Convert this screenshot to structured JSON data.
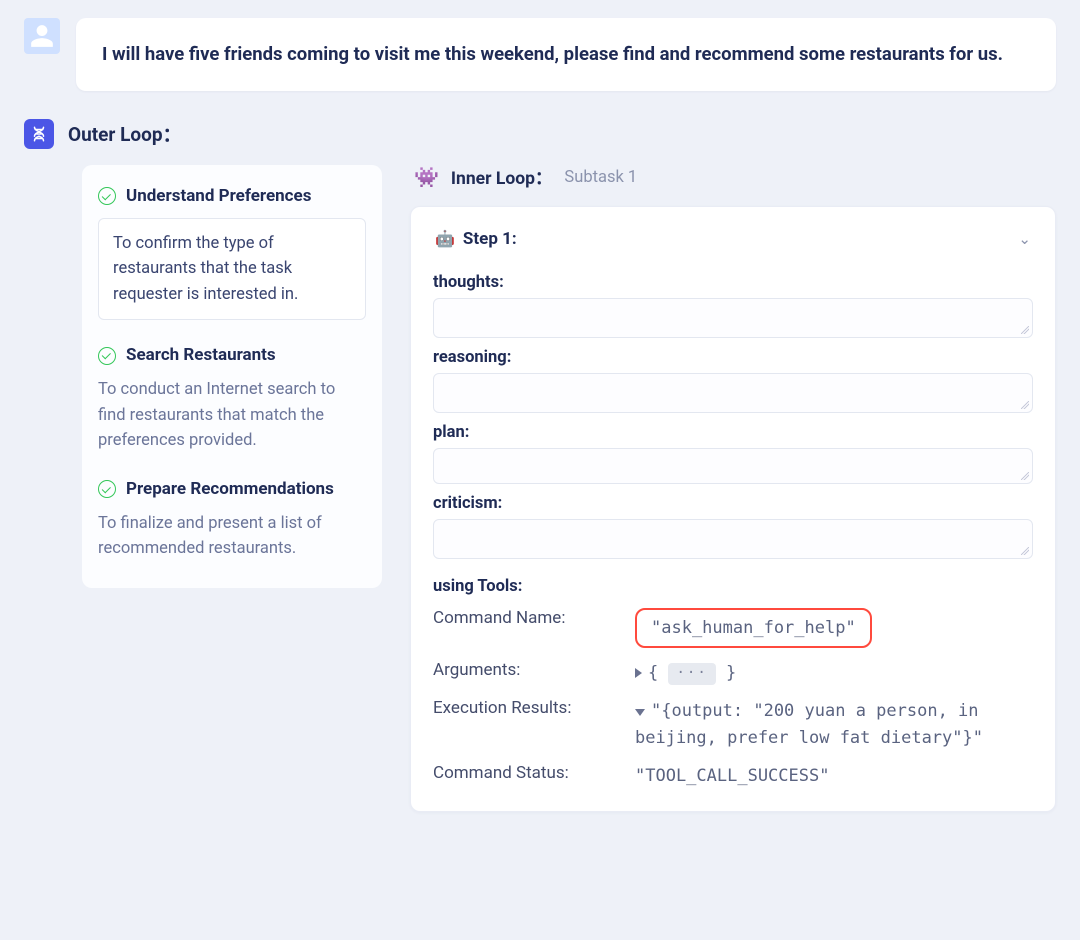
{
  "user_message": "I will have five friends coming to visit me this weekend, please find and recommend some restaurants for us.",
  "outer": {
    "title": "Outer Loop：",
    "subgoals": [
      {
        "title": "Understand Preferences",
        "desc": "To confirm the type of restaurants that the task requester is interested in.",
        "boxed": true
      },
      {
        "title": "Search Restaurants",
        "desc": "To conduct an Internet search to find restaurants that match the preferences provided.",
        "boxed": false
      },
      {
        "title": "Prepare Recommendations",
        "desc": "To finalize and present a list of recommended restaurants.",
        "boxed": false
      }
    ]
  },
  "inner": {
    "emoji": "👾",
    "title": "Inner Loop：",
    "subtitle": "Subtask 1",
    "step": {
      "emoji": "🤖",
      "title": "Step 1:",
      "fields": {
        "thoughts_label": "thoughts:",
        "reasoning_label": "reasoning:",
        "plan_label": "plan:",
        "criticism_label": "criticism:"
      },
      "tools": {
        "heading": "using Tools:",
        "rows": {
          "command_name_label": "Command Name:",
          "command_name_value": "\"ask_human_for_help\"",
          "arguments_label": "Arguments:",
          "arguments_value_prefix": "{ ",
          "arguments_value_suffix": " }",
          "arguments_ellipsis": "···",
          "exec_label": "Execution Results:",
          "exec_value": "\"{output: \"200 yuan a person, in beijing, prefer low fat dietary\"}\"",
          "status_label": "Command Status:",
          "status_value": "\"TOOL_CALL_SUCCESS\""
        }
      }
    }
  }
}
